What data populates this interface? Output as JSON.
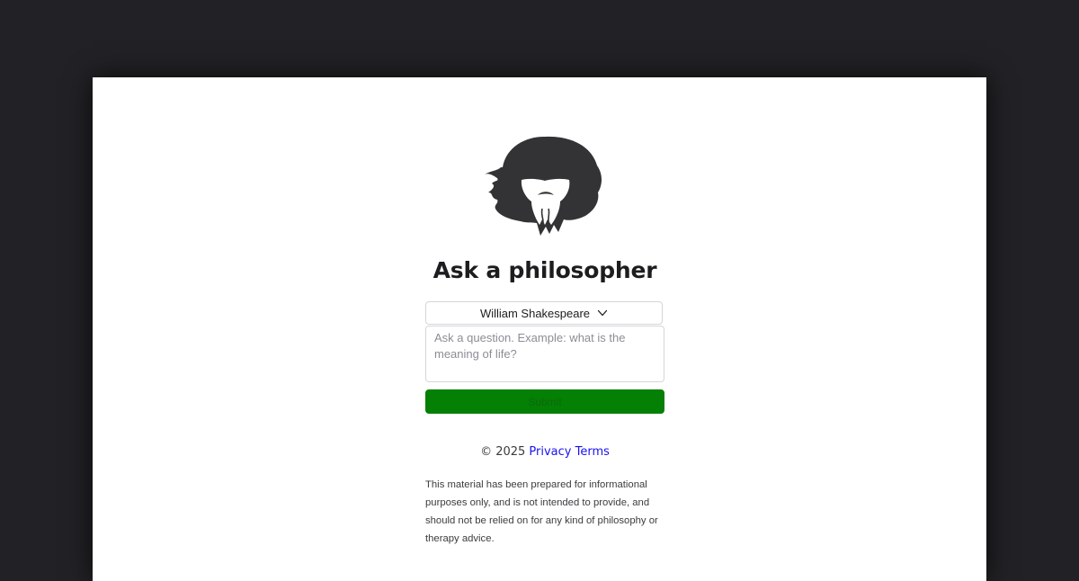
{
  "header": {
    "title": "Ask a philosopher"
  },
  "form": {
    "philosopher_selected": "William Shakespeare",
    "question_placeholder": "Ask a question. Example: what is the meaning of life?",
    "question_value": "",
    "submit_label": "Submit"
  },
  "footer": {
    "copyright": "© 2025",
    "privacy_label": "Privacy",
    "terms_label": "Terms",
    "disclaimer": "This material has been prepared for informational purposes only, and is not intended to provide, and should not be relied on for any kind of philosophy or therapy advice."
  },
  "icons": {
    "logo": "philosopher-logo-icon",
    "select_chevron": "chevron-down-icon"
  },
  "colors": {
    "backdrop": "#222226",
    "page_background": "#ffffff",
    "submit_button": "#048004",
    "link": "#1a12ee",
    "title_text": "#1d1d1f"
  }
}
